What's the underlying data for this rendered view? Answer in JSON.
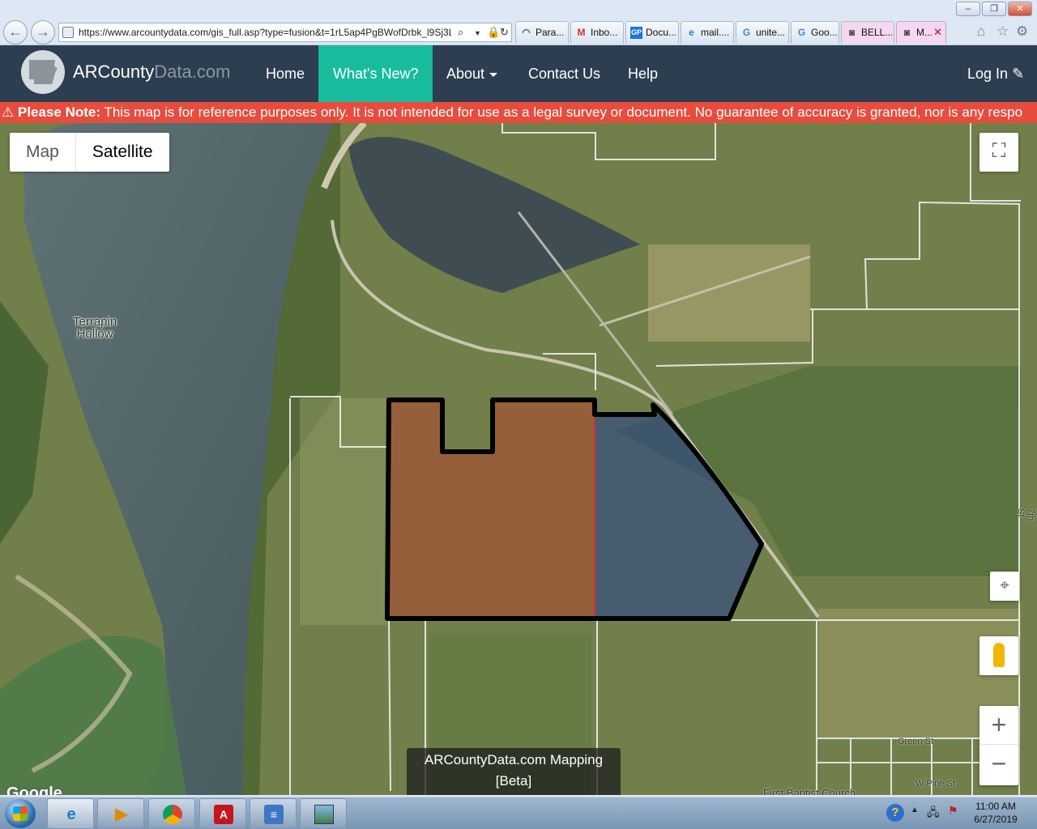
{
  "browser": {
    "url": "https://www.arcountydata.com/gis_full.asp?type=fusion&t=1rL5ap4PgBWofDrbk_l9Sj3L",
    "tabs": [
      {
        "label": "Para...",
        "icon": "app-icon"
      },
      {
        "label": "Inbo...",
        "icon": "gmail-icon"
      },
      {
        "label": "Docu...",
        "icon": "docu-icon"
      },
      {
        "label": "mail....",
        "icon": "ie-icon"
      },
      {
        "label": "unite...",
        "icon": "google-icon"
      },
      {
        "label": "Goo...",
        "icon": "google-icon"
      },
      {
        "label": "BELL...",
        "icon": "app-icon"
      },
      {
        "label": "M...",
        "icon": "app-icon",
        "active": true
      }
    ]
  },
  "site": {
    "logo_main": "ARCounty",
    "logo_dim": "Data.com",
    "nav": {
      "home": "Home",
      "whats_new": "What's New?",
      "about": "About",
      "contact": "Contact Us",
      "help": "Help",
      "login": "Log In"
    },
    "notice_bold": "Please Note:",
    "notice_text": " This map is for reference purposes only. It is not intended for use as a legal survey or document. No guarantee of accuracy is granted, nor is any respo"
  },
  "map": {
    "type_map": "Map",
    "type_satellite": "Satellite",
    "selected_type": "Satellite",
    "place_labels": {
      "terrapin_line1": "Terrapin",
      "terrapin_line2": "Hollow",
      "green_st": "Green St",
      "w_pine_st": "W Pine St",
      "church": "First Baptist Church",
      "seventh_st": "7th St"
    },
    "attribution": "Google",
    "banner_line1": "ARCountyData.com Mapping",
    "banner_line2": "[Beta]",
    "zoom_in": "+",
    "zoom_out": "−"
  },
  "taskbar": {
    "time": "11:00 AM",
    "date": "6/27/2019"
  },
  "colors": {
    "navbar": "#2c3e50",
    "nav_active": "#18bc9c",
    "notice": "#e74c3c",
    "parcel_red": "#c0392b",
    "parcel_blue": "#1f3a93"
  }
}
